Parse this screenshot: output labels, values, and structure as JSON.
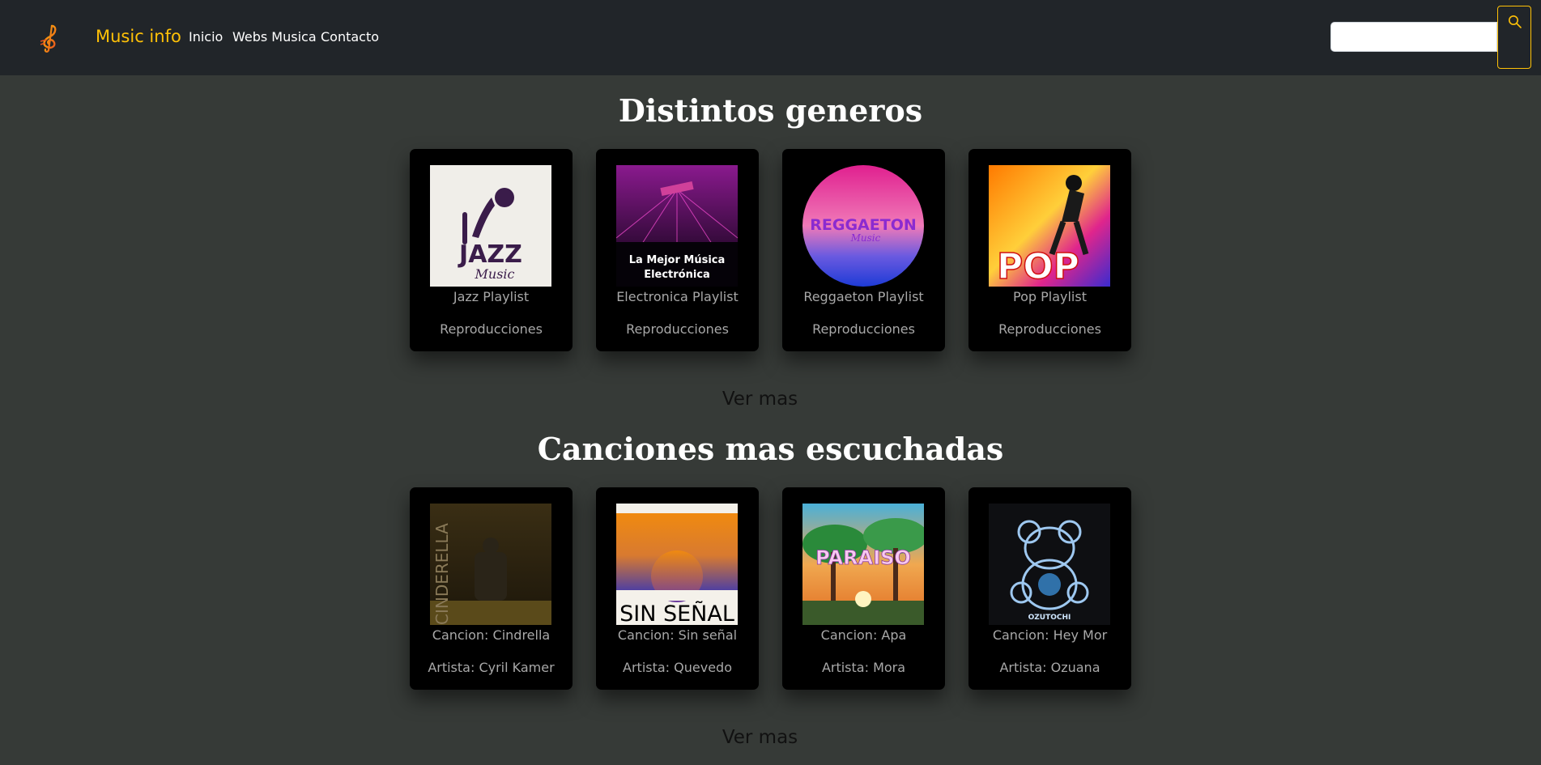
{
  "navbar": {
    "brand": "Music info",
    "links": [
      "Inicio",
      "Webs Musica",
      "Contacto"
    ],
    "search_placeholder": "",
    "search_icon": "search-icon",
    "logo_icon": "treble-clef-icon"
  },
  "colors": {
    "navbar_bg": "#212529",
    "page_bg": "#363a37",
    "brand": "#ffc107",
    "card_bg": "#000000"
  },
  "sections": [
    {
      "title": "Distintos generos",
      "cards": [
        {
          "line1": "Jazz Playlist",
          "line2": "Reproducciones",
          "image_text": [
            "JAZZ",
            "Music"
          ]
        },
        {
          "line1": "Electronica Playlist",
          "line2": "Reproducciones",
          "image_text": [
            "La Mejor Música",
            "Electrónica"
          ]
        },
        {
          "line1": "Reggaeton Playlist",
          "line2": "Reproducciones",
          "image_text": [
            "REGGAETON",
            "Music"
          ]
        },
        {
          "line1": "Pop Playlist",
          "line2": "Reproducciones",
          "image_text": [
            "POP"
          ]
        }
      ],
      "more": "Ver mas"
    },
    {
      "title": "Canciones mas escuchadas",
      "cards": [
        {
          "line1": "Cancion: Cindrella",
          "line2": "Artista: Cyril Kamer",
          "image_text": [
            "CINDERELLA"
          ]
        },
        {
          "line1": "Cancion: Sin señal",
          "line2": "Artista: Quevedo",
          "image_text": [
            "SIN SEÑAL"
          ]
        },
        {
          "line1": "Cancion: Apa",
          "line2": "Artista: Mora",
          "image_text": [
            "PARAISO"
          ]
        },
        {
          "line1": "Cancion: Hey Mor",
          "line2": "Artista: Ozuana",
          "image_text": [
            "OZUTOCHI"
          ]
        }
      ],
      "more": "Ver mas"
    }
  ]
}
